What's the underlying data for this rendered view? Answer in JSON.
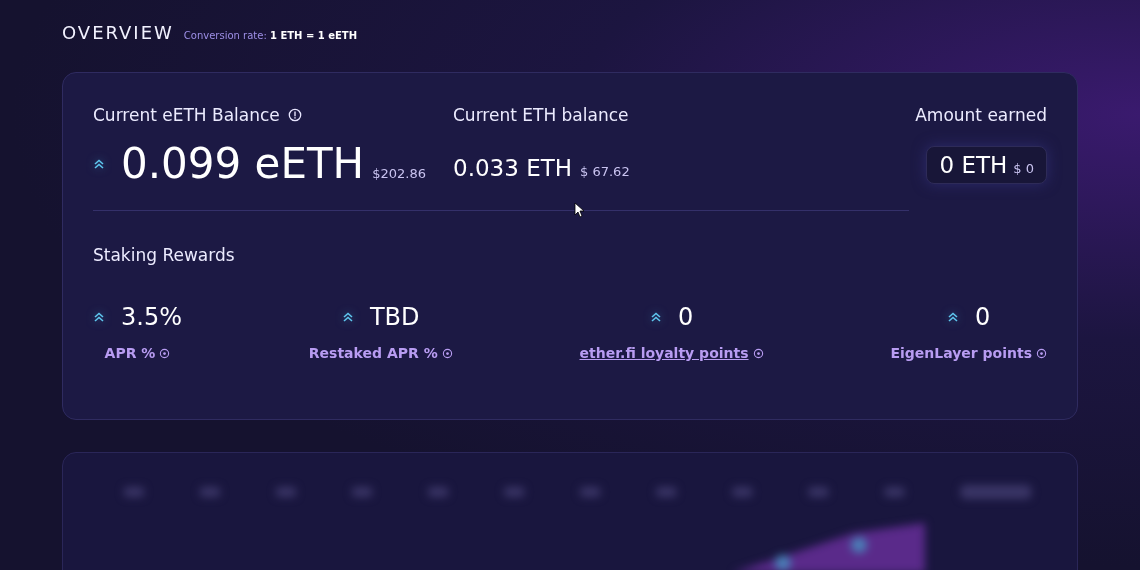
{
  "header": {
    "title": "OVERVIEW",
    "conversion_label": "Conversion rate:",
    "conversion_value": "1 ETH = 1 eETH"
  },
  "balances": {
    "eeth": {
      "label": "Current eETH Balance",
      "value": "0.099 eETH",
      "usd": "$202.86"
    },
    "eth": {
      "label": "Current ETH balance",
      "value": "0.033 ETH",
      "usd": "$ 67.62"
    },
    "earned": {
      "label": "Amount earned",
      "value": "0 ETH",
      "usd": "$ 0"
    }
  },
  "staking": {
    "title": "Staking Rewards",
    "stats": [
      {
        "value": "3.5%",
        "label": "APR %",
        "kind": "text"
      },
      {
        "value": "TBD",
        "label": "Restaked APR %",
        "kind": "text"
      },
      {
        "value": "0",
        "label": "ether.fi loyalty points",
        "kind": "link"
      },
      {
        "value": "0",
        "label": "EigenLayer points",
        "kind": "text"
      }
    ]
  }
}
